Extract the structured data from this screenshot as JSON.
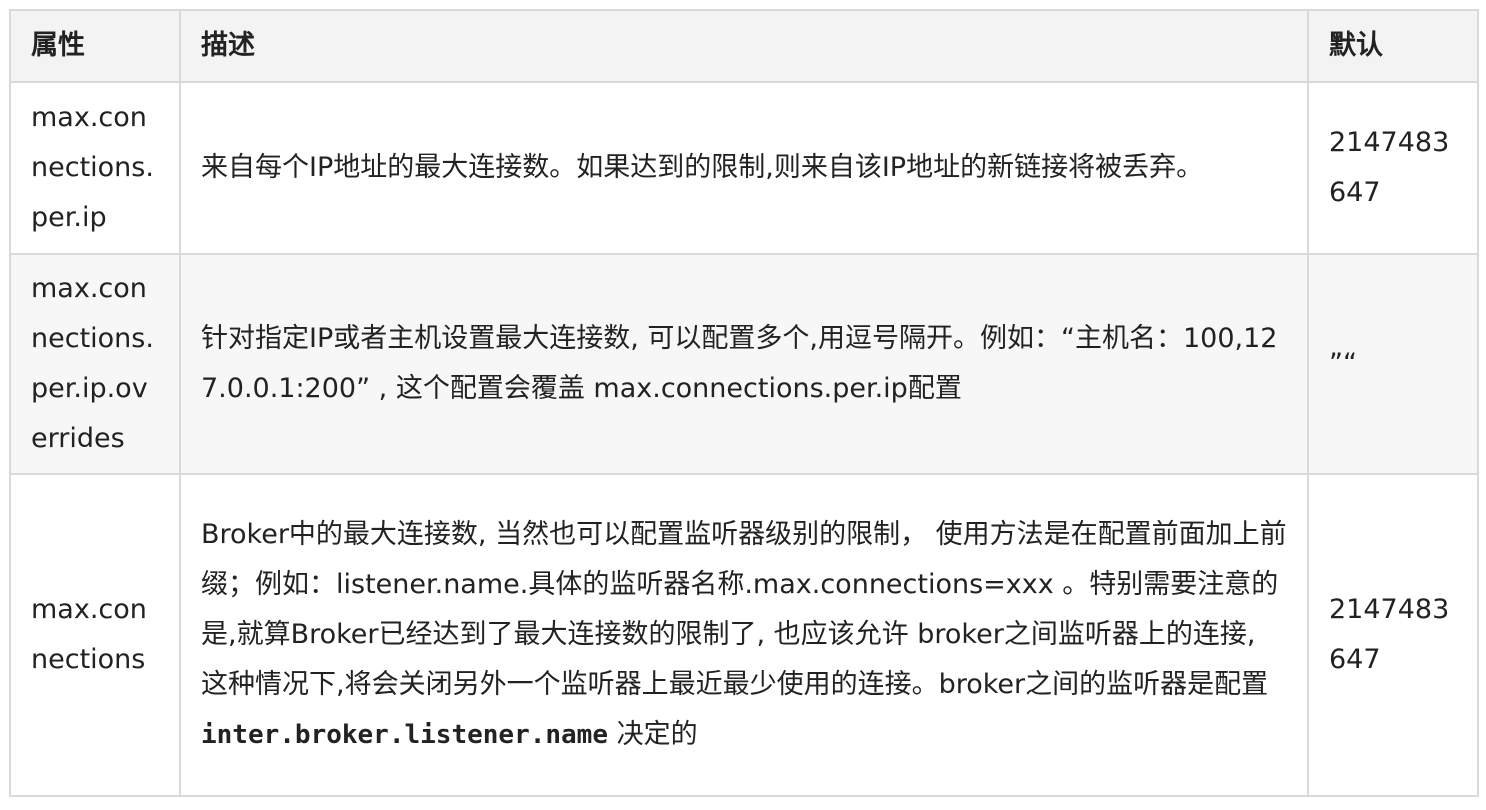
{
  "table": {
    "headers": {
      "property": "属性",
      "description": "描述",
      "default": "默认"
    },
    "rows": [
      {
        "property": "max.connections.per.ip",
        "description": "来自每个IP地址的最大连接数。如果达到的限制,则来自该IP地址的新链接将被丢弃。",
        "default": "2147483647"
      },
      {
        "property": "max.connections.per.ip.overrides",
        "description": "针对指定IP或者主机设置最大连接数, 可以配置多个,用逗号隔开。例如：“主机名：100,127.0.0.1:200” , 这个配置会覆盖 max.connections.per.ip配置",
        "default": "”“"
      },
      {
        "property": "max.connections",
        "description": "Broker中的最大连接数, 当然也可以配置监听器级别的限制， 使用方法是在配置前面加上前缀；例如：listener.name.具体的监听器名称.max.connections=xxx 。特别需要注意的是,就算Broker已经达到了最大连接数的限制了, 也应该允许 broker之间监听器上的连接, 这种情况下,将会关闭另外一个监听器上最近最少使用的连接。broker之间的监听器是配置 ",
        "description_code": "inter.broker.listener.name",
        "description_suffix": " 决定的",
        "default": "2147483647"
      }
    ]
  }
}
